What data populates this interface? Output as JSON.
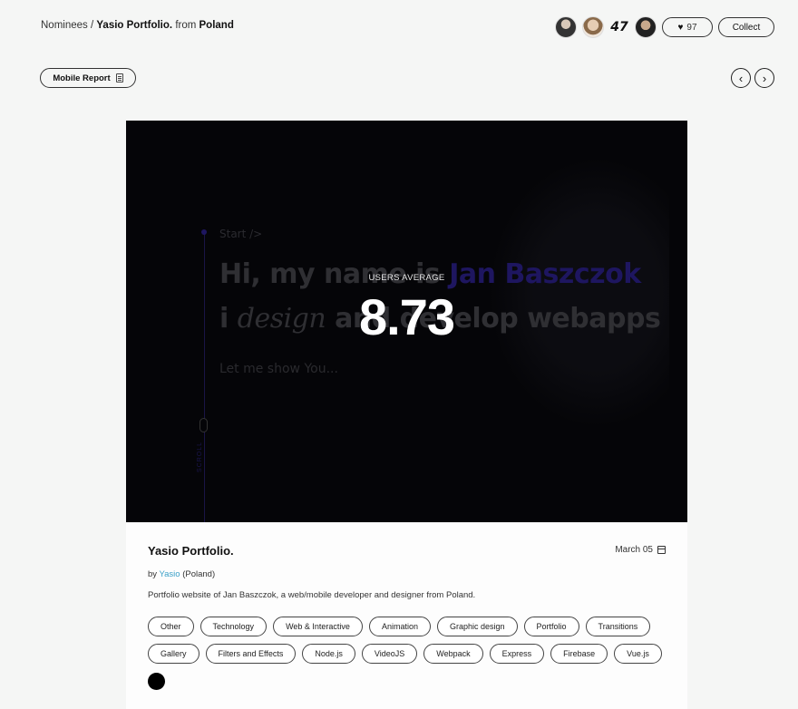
{
  "breadcrumb": {
    "section": "Nominees",
    "separator": "/",
    "site": "Yasio Portfolio.",
    "from": "from",
    "country": "Poland"
  },
  "header": {
    "likes": "97",
    "collect_label": "Collect",
    "logo_text": "47"
  },
  "mobile_report_label": "Mobile Report",
  "hero": {
    "start": "Start />",
    "line1_pre": "Hi, my name is ",
    "line1_name": "Jan Baszczok",
    "line2_pre": "i ",
    "line2_em": "design",
    "line2_post": " and develop webapps",
    "line3": "Let me show You...",
    "scroll_text": "SCROLL",
    "users_average_label": "USERS AVERAGE",
    "users_average_score": "8.73"
  },
  "card": {
    "title": "Yasio Portfolio.",
    "date": "March 05",
    "by_prefix": "by",
    "author": "Yasio",
    "author_country": "(Poland)",
    "description": "Portfolio website of Jan Baszczok, a web/mobile developer and designer from Poland.",
    "tags_row1": [
      "Other",
      "Technology",
      "Web & Interactive",
      "Animation",
      "Graphic design",
      "Portfolio",
      "Transitions"
    ],
    "tags_row2": [
      "Gallery",
      "Filters and Effects",
      "Node.js",
      "VideoJS",
      "Webpack",
      "Express",
      "Firebase",
      "Vue.js"
    ]
  },
  "icons": {
    "heart": "heart-icon",
    "document": "document-icon",
    "calendar": "calendar-icon",
    "prev": "chevron-left-icon",
    "next": "chevron-right-icon"
  },
  "colors": {
    "page_bg": "#f5f6f5",
    "hero_bg": "#050508",
    "accent_name": "#1e1660",
    "author_link": "#3aa0c8"
  }
}
